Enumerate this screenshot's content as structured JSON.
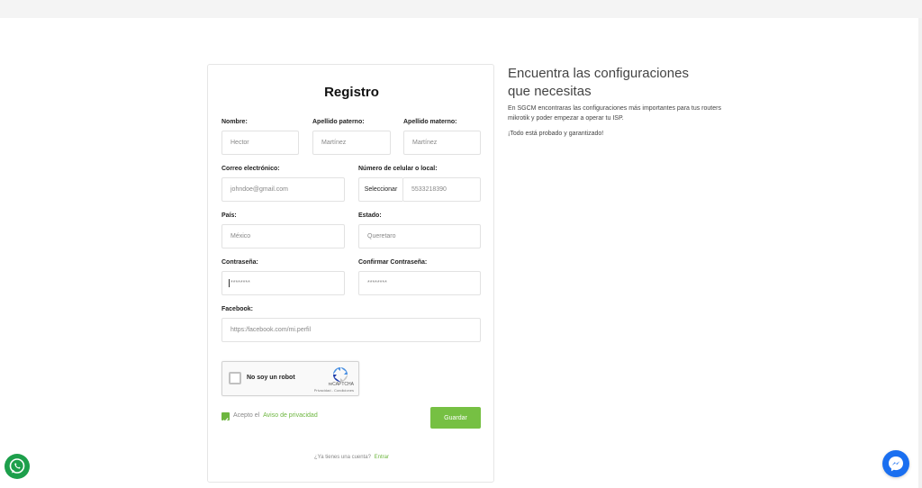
{
  "form": {
    "title": "Registro",
    "fields": {
      "nombre": {
        "label": "Nombre:",
        "placeholder": "Hector"
      },
      "apellido_paterno": {
        "label": "Apellido paterno:",
        "placeholder": "Martínez"
      },
      "apellido_materno": {
        "label": "Apellido materno:",
        "placeholder": "Martínez"
      },
      "correo": {
        "label": "Correo electrónico:",
        "placeholder": "johndoe@gmail.com"
      },
      "celular": {
        "label": "Número de celular o local:",
        "select_value": "Seleccionar",
        "placeholder": "5533218390"
      },
      "pais": {
        "label": "País:",
        "placeholder": "México"
      },
      "estado": {
        "label": "Estado:",
        "placeholder": "Queretaro"
      },
      "contrasena": {
        "label": "Contraseña:",
        "placeholder": "********"
      },
      "confirmar_contrasena": {
        "label": "Confirmar Contraseña:",
        "placeholder": "********"
      },
      "facebook": {
        "label": "Facebook:",
        "placeholder": "https:/facebook.com/mi.perfil"
      }
    },
    "recaptcha": {
      "label": "No soy un robot",
      "brand": "reCAPTCHA",
      "terms": "Privacidad - Condiciones"
    },
    "accept": {
      "text": "Acepto el",
      "link": "Aviso de privacidad",
      "checked": true
    },
    "save_label": "Guardar",
    "login": {
      "text": "¿Ya tienes una cuenta?",
      "link": "Entrar"
    }
  },
  "side": {
    "title": "Encuentra las configuraciones que necesitas",
    "description": "En SGCM encontraras las configuraciones más importantes para tus routers mikrotik y poder empezar a operar tu ISP.",
    "note": "¡Todo está probado y garantizado!"
  },
  "floating": {
    "whatsapp_icon": "whatsapp-icon",
    "messenger_icon": "messenger-icon"
  },
  "colors": {
    "accent": "#76c043",
    "link": "#6db63f",
    "whatsapp": "#1d9f4b",
    "messenger": "#1a6ff0"
  }
}
